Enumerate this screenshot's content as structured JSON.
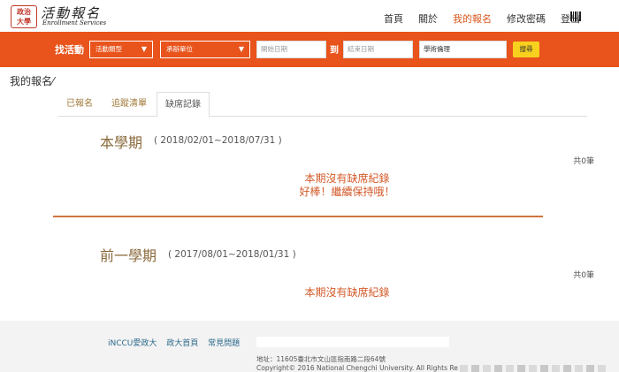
{
  "logo": {
    "seal_line1": "政治",
    "seal_line2": "大學",
    "main": "活動報名",
    "sub": "Enrollment Services"
  },
  "nav": [
    {
      "label": "首頁",
      "active": false
    },
    {
      "label": "關於",
      "active": false
    },
    {
      "label": "我的報名",
      "active": true
    },
    {
      "label": "修改密碼",
      "active": false
    },
    {
      "label": "登出",
      "active": false
    }
  ],
  "search": {
    "find_label": "找活動",
    "type_select": "活動類型",
    "org_select": "承辦單位",
    "start_placeholder": "開始日期",
    "to_label": "到",
    "end_placeholder": "結束日期",
    "category_value": "學術倫理",
    "button": "搜尋"
  },
  "page_title": "我的報名",
  "tabs": [
    {
      "label": "已報名",
      "active": false
    },
    {
      "label": "追蹤清單",
      "active": false
    },
    {
      "label": "缺席記錄",
      "active": true
    }
  ],
  "sections": [
    {
      "title": "本學期",
      "range": "( 2018/02/01~2018/07/31 )",
      "count": "共0筆",
      "messages": [
        "本期沒有缺席紀錄",
        "好棒！繼續保持哦！"
      ]
    },
    {
      "title": "前一學期",
      "range": "( 2017/08/01~2018/01/31 )",
      "count": "共0筆",
      "messages": [
        "本期沒有缺席紀錄"
      ]
    }
  ],
  "footer": {
    "links": [
      "iNCCU愛政大",
      "政大首頁",
      "常見問題"
    ],
    "address": "地址：11605臺北市文山區指南路二段64號",
    "copyright": "Copyright© 2016 National Chengchi University. All Rights Re"
  }
}
